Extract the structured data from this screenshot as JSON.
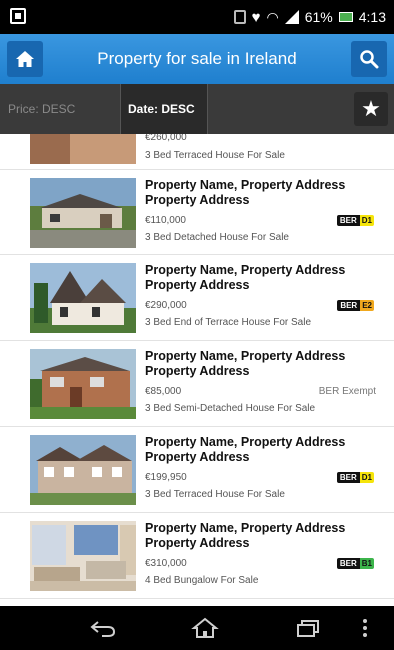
{
  "status_bar": {
    "battery_percent": "61%",
    "time": "4:13",
    "icons": [
      "notification-icon",
      "vibrate-icon",
      "wifi-icon",
      "signal-icon",
      "battery-icon"
    ]
  },
  "app_bar": {
    "title": "Property for sale in Ireland",
    "home_icon": "home-icon",
    "search_icon": "search-icon"
  },
  "sort_bar": {
    "price_sort": "Price: DESC",
    "date_sort": "Date: DESC",
    "favorites_icon": "star-icon"
  },
  "listings": [
    {
      "name": "",
      "price": "€260,000",
      "description": "3 Bed Terraced House For Sale",
      "ber": "",
      "ber_rating": "",
      "ber_color": ""
    },
    {
      "name": "Property Name, Property Address Property Address",
      "price": "€110,000",
      "description": "3 Bed Detached House For Sale",
      "ber": "BER",
      "ber_rating": "D1",
      "ber_color": "#f5e40a"
    },
    {
      "name": "Property Name, Property Address Property Address",
      "price": "€290,000",
      "description": "3 Bed End of Terrace House For Sale",
      "ber": "BER",
      "ber_rating": "E2",
      "ber_color": "#f0a81e"
    },
    {
      "name": "Property Name, Property Address Property Address",
      "price": "€85,000",
      "description": "3 Bed Semi-Detached House For Sale",
      "ber_exempt": "BER Exempt"
    },
    {
      "name": "Property Name, Property Address Property Address",
      "price": "€199,950",
      "description": "3 Bed Terraced House For Sale",
      "ber": "BER",
      "ber_rating": "D1",
      "ber_color": "#f5e40a"
    },
    {
      "name": "Property Name, Property Address Property Address",
      "price": "€310,000",
      "description": "4 Bed Bungalow For Sale",
      "ber": "BER",
      "ber_rating": "B1",
      "ber_color": "#3cb44b"
    }
  ],
  "nav_bar": {
    "icons": [
      "back-icon",
      "home-icon",
      "recent-apps-icon",
      "menu-icon"
    ]
  },
  "colors": {
    "app_bar": "#2a88d8",
    "sort_bar": "#3a3a3a",
    "status_bar": "#000000"
  }
}
